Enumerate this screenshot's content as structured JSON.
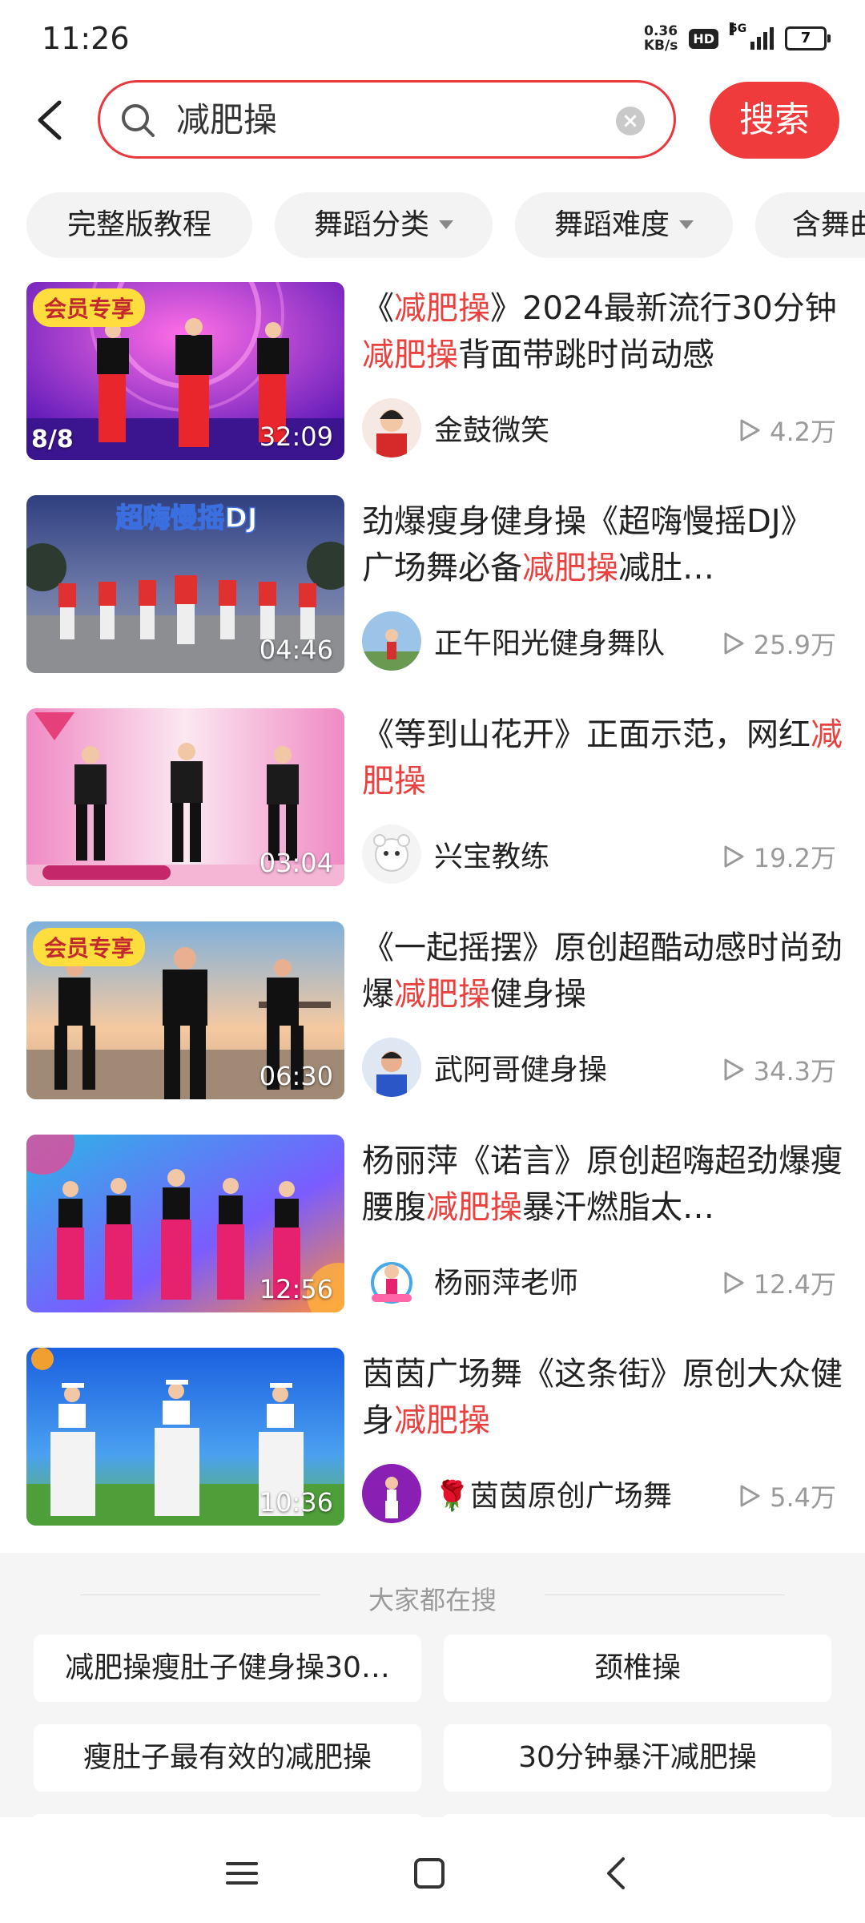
{
  "status_bar": {
    "time": "11:26",
    "net_speed_value": "0.36",
    "net_speed_unit": "KB/s",
    "hd": "HD",
    "network": "5G",
    "battery": "7"
  },
  "search": {
    "query": "减肥操",
    "button_label": "搜索"
  },
  "filters": [
    {
      "label": "完整版教程",
      "dropdown": false
    },
    {
      "label": "舞蹈分类",
      "dropdown": true
    },
    {
      "label": "舞蹈难度",
      "dropdown": true
    },
    {
      "label": "含舞曲",
      "dropdown": false
    }
  ],
  "videos": [
    {
      "title_parts": [
        {
          "t": "《",
          "hl": false
        },
        {
          "t": "减肥操",
          "hl": true
        },
        {
          "t": "》2024最新流行30分钟",
          "hl": false
        },
        {
          "t": "减肥操",
          "hl": true
        },
        {
          "t": "背面带跳时尚动感",
          "hl": false
        }
      ],
      "author": "金鼓微笑",
      "views": "4.2万",
      "duration": "32:09",
      "badge": "会员专享",
      "episodes": "8/8"
    },
    {
      "title_parts": [
        {
          "t": "劲爆瘦身健身操《超嗨慢摇DJ》广场舞必备",
          "hl": false
        },
        {
          "t": "减肥操",
          "hl": true
        },
        {
          "t": "减肚…",
          "hl": false
        }
      ],
      "author": "正午阳光健身舞队",
      "views": "25.9万",
      "duration": "04:46",
      "thumb_text": "超嗨慢摇DJ"
    },
    {
      "title_parts": [
        {
          "t": "《等到山花开》正面示范，网红",
          "hl": false
        },
        {
          "t": "减肥操",
          "hl": true
        }
      ],
      "author": "兴宝教练",
      "views": "19.2万",
      "duration": "03:04"
    },
    {
      "title_parts": [
        {
          "t": "《一起摇摆》原创超酷动感时尚劲爆",
          "hl": false
        },
        {
          "t": "减肥操",
          "hl": true
        },
        {
          "t": "健身操",
          "hl": false
        }
      ],
      "author": "武阿哥健身操",
      "views": "34.3万",
      "duration": "06:30",
      "badge": "会员专享"
    },
    {
      "title_parts": [
        {
          "t": "杨丽萍《诺言》原创超嗨超劲爆瘦腰腹",
          "hl": false
        },
        {
          "t": "减肥操",
          "hl": true
        },
        {
          "t": "暴汗燃脂太…",
          "hl": false
        }
      ],
      "author": "杨丽萍老师",
      "views": "12.4万",
      "duration": "12:56"
    },
    {
      "title_parts": [
        {
          "t": "茵茵广场舞《这条街》原创大众健身",
          "hl": false
        },
        {
          "t": "减肥操",
          "hl": true
        }
      ],
      "author": "🌹茵茵原创广场舞",
      "views": "5.4万",
      "duration": "10:36"
    }
  ],
  "hot_searches": {
    "title": "大家都在搜",
    "items": [
      "减肥操瘦肚子健身操30…",
      "颈椎操",
      "瘦肚子最有效的减肥操",
      "30分钟暴汗减肥操"
    ]
  },
  "colors": {
    "accent": "#ef3b3b",
    "highlight": "#e8413f",
    "vip_badge_bg": "#ffdd3c"
  }
}
